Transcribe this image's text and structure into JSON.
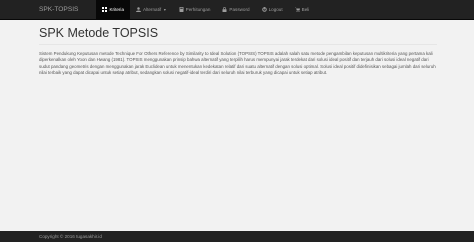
{
  "navbar": {
    "brand": "SPK-TOPSIS",
    "items": [
      {
        "label": "Kriteria",
        "icon": "grid-icon",
        "active": true
      },
      {
        "label": "Alternatif",
        "icon": "user-icon",
        "active": false,
        "dropdown": true
      },
      {
        "label": "Perhitungan",
        "icon": "calculator-icon",
        "active": false
      },
      {
        "label": "Password",
        "icon": "lock-icon",
        "active": false
      },
      {
        "label": "Logout",
        "icon": "logout-icon",
        "active": false
      },
      {
        "label": "Beli",
        "icon": "cart-icon",
        "active": false
      }
    ]
  },
  "main": {
    "title": "SPK Metode TOPSIS",
    "description": "Sistem Pendukung Keputusan metode Technique For Others Reference by Similarity to Ideal Solution (TOPSIS) TOPSIS adalah salah satu metode pengambilan keputusan multikriteria yang pertama kali diperkenalkan oleh Yoon dan Hwang (1981). TOPSIS menggunakan prinsip bahwa alternatif yang terpilih harus mempunyai jarak terdekat dari solusi ideal positif dan terjauh dari solusi ideal negatif dari sudut pandang geometris dengan menggunakan jarak Euclidean untuk menentukan kedekatan relatif dari suatu alternatif dengan solusi optimal. Solusi ideal positif didefinisikan sebagai jumlah dari seluruh nilai terbaik yang dapat dicapai untuk setiap atribut, sedangkan solusi negatif-ideal terdiri dari seluruh nilai terburuk yang dicapai untuk setiap atribut."
  },
  "footer": {
    "text": "Copyright © 2016 tugasakhir.id"
  },
  "colors": {
    "navbar_bg": "#222222",
    "active_bg": "#080808",
    "page_bg": "#f2f2f2"
  }
}
